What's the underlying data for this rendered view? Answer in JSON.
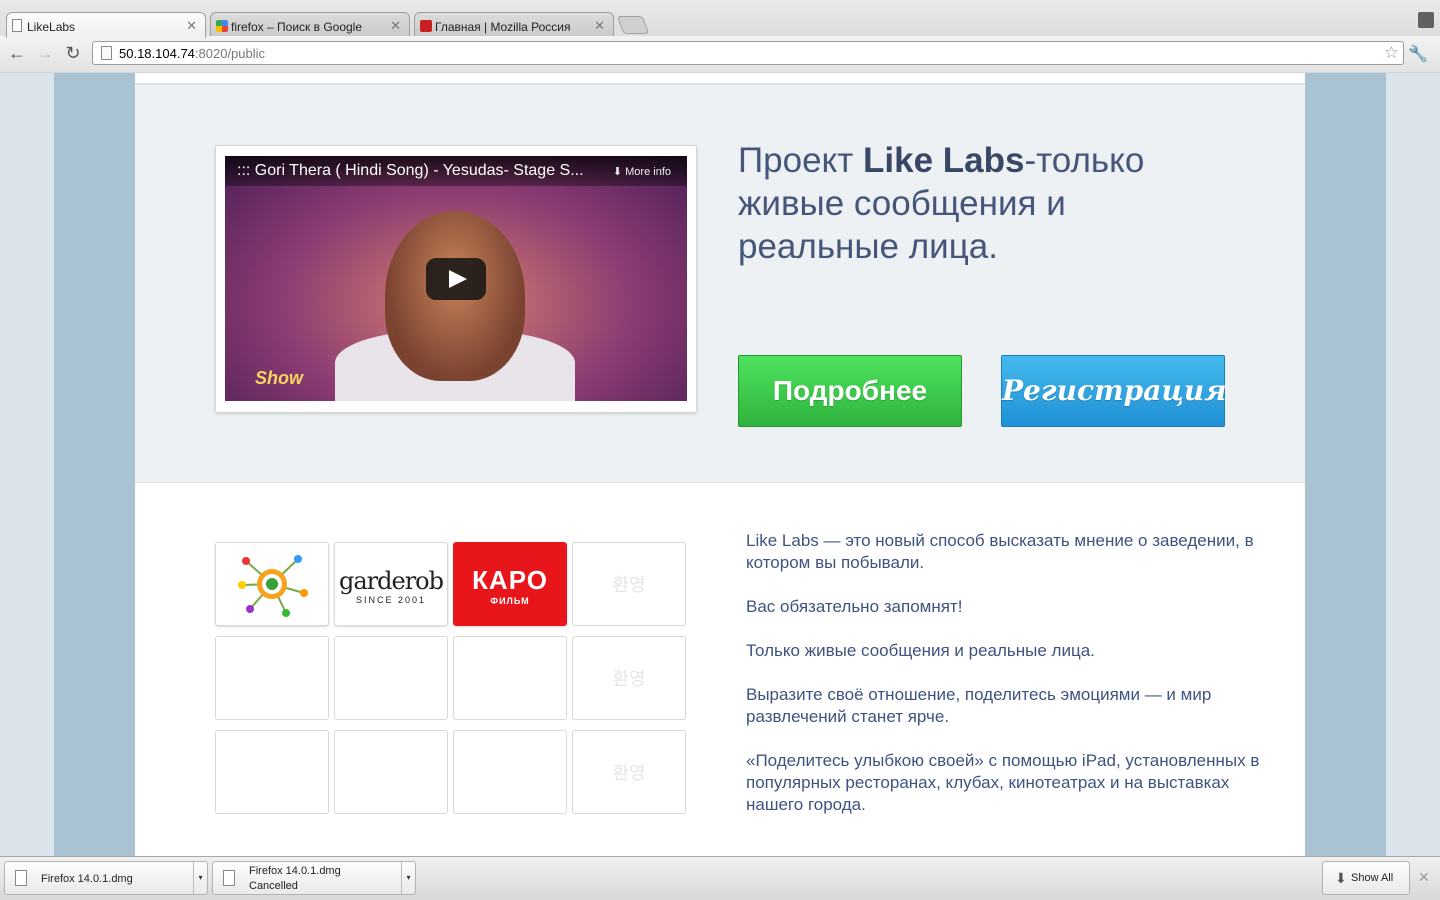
{
  "browser": {
    "tabs": [
      {
        "title": "LikeLabs"
      },
      {
        "title": "firefox – Поиск в Google"
      },
      {
        "title": "Главная | Mozilla Россия"
      }
    ],
    "url_host": "50.18.104.74",
    "url_rest": ":8020/public"
  },
  "hero": {
    "video_title": "::: Gori Thera ( Hindi Song) - Yesudas- Stage S...",
    "video_more": "More info",
    "video_logo": "Show",
    "headline_part1": "Проект ",
    "headline_brand": "Like Labs",
    "headline_part2": "-только живые сообщения и реальные лица.",
    "btn_more": "Подробнее",
    "btn_register": "Регистрация"
  },
  "partners": {
    "garderob_name": "garderob",
    "garderob_since": "SINCE 2001",
    "karo_name": "КАРО",
    "karo_sub": "ФИЛЬМ",
    "faint_korean": "환영"
  },
  "description": {
    "p1": "Like Labs — это новый способ высказать мнение о заведении, в котором вы побывали.",
    "p2": "Вас обязательно запомнят!",
    "p3": "Только живые сообщения и реальные лица.",
    "p4": "Выразите своё отношение, поделитесь эмоциями — и мир развлечений станет ярче.",
    "p5": "«Поделитесь улыбкою своей» с помощью iPad, установленных в популярных ресторанах, клубах, кинотеатрах и на выставках нашего города."
  },
  "downloads": {
    "item1_name": "Firefox 14.0.1.dmg",
    "item2_name": "Firefox 14.0.1.dmg",
    "item2_status": "Cancelled",
    "show_all": "Show All"
  },
  "colors": {
    "accent_green": "#3cc94b",
    "accent_blue": "#2aa2e2",
    "text_blue": "#3f5380"
  }
}
